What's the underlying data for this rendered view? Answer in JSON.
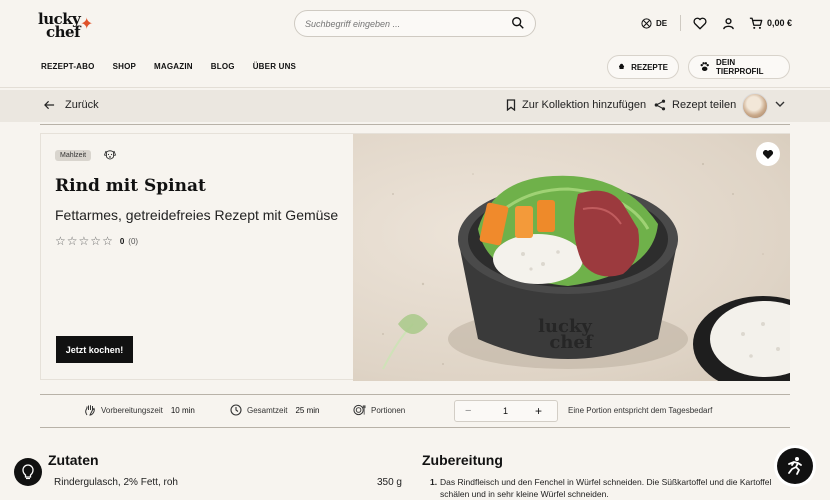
{
  "header": {
    "logo_line1": "lucky",
    "logo_line2": "chef",
    "search_placeholder": "Suchbegriff eingeben ...",
    "language": "DE",
    "cart_total": "0,00 €"
  },
  "nav": {
    "items": [
      "REZEPT-ABO",
      "SHOP",
      "MAGAZIN",
      "BLOG",
      "ÜBER UNS"
    ],
    "rezepte_label": "REZEPTE",
    "tierprofil_label": "DEIN TIERPROFIL"
  },
  "subbar": {
    "back_label": "Zurück",
    "collection_label": "Zur Kollektion hinzufügen",
    "share_label": "Rezept teilen"
  },
  "recipe": {
    "badge": "Mahlzeit",
    "title": "Rind mit Spinat",
    "subtitle": "Fettarmes, getreidefreies Rezept mit Gemüse",
    "rating_value": "0",
    "rating_count": "(0)",
    "cook_button": "Jetzt kochen!",
    "bowl_text_1": "lucky",
    "bowl_text_2": "chef"
  },
  "info": {
    "prep_label": "Vorbereitungszeit",
    "prep_value": "10 min",
    "total_label": "Gesamtzeit",
    "total_value": "25 min",
    "portions_label": "Portionen",
    "portions_value": "1",
    "portions_note": "Eine Portion entspricht dem Tagesbedarf"
  },
  "ingredients": {
    "heading": "Zutaten",
    "items": [
      {
        "name": "Rindergulasch, 2% Fett, roh",
        "amount": "350 g"
      }
    ]
  },
  "preparation": {
    "heading": "Zubereitung",
    "steps": [
      "Das Rindfleisch und den Fenchel in Würfel schneiden. Die Süßkartoffel und die Kartoffel schälen und in sehr kleine Würfel schneiden."
    ]
  }
}
